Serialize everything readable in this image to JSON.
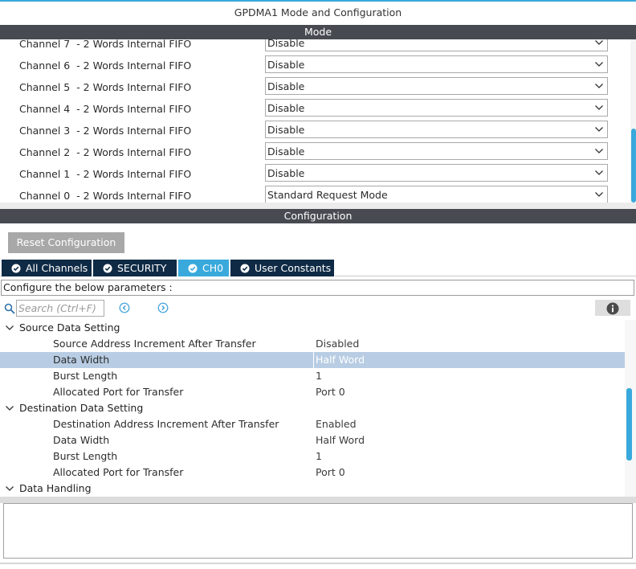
{
  "window": {
    "title": "GPDMA1 Mode and Configuration"
  },
  "mode": {
    "header": "Mode",
    "rows": [
      {
        "label": "Channel 7  - 2 Words Internal FIFO",
        "value": "Disable"
      },
      {
        "label": "Channel 6  - 2 Words Internal FIFO",
        "value": "Disable"
      },
      {
        "label": "Channel 5  - 2 Words Internal FIFO",
        "value": "Disable"
      },
      {
        "label": "Channel 4  - 2 Words Internal FIFO",
        "value": "Disable"
      },
      {
        "label": "Channel 3  - 2 Words Internal FIFO",
        "value": "Disable"
      },
      {
        "label": "Channel 2  - 2 Words Internal FIFO",
        "value": "Disable"
      },
      {
        "label": "Channel 1  - 2 Words Internal FIFO",
        "value": "Disable"
      },
      {
        "label": "Channel 0  - 2 Words Internal FIFO",
        "value": "Standard Request Mode"
      }
    ]
  },
  "configuration": {
    "header": "Configuration",
    "reset_label": "Reset Configuration",
    "tabs": [
      {
        "label": "All Channels",
        "active": false
      },
      {
        "label": "SECURITY",
        "active": false
      },
      {
        "label": "CH0",
        "active": true
      },
      {
        "label": "User Constants",
        "active": false
      }
    ],
    "caption": "Configure the below parameters :",
    "search_placeholder": "Search (Ctrl+F)",
    "groups": [
      {
        "label": "Source Data Setting",
        "params": [
          {
            "label": "Source Address Increment After Transfer",
            "value": "Disabled"
          },
          {
            "label": "Data Width",
            "value": "Half Word",
            "selected": true
          },
          {
            "label": "Burst Length",
            "value": "1"
          },
          {
            "label": "Allocated Port for Transfer",
            "value": "Port 0"
          }
        ]
      },
      {
        "label": "Destination Data Setting",
        "params": [
          {
            "label": "Destination Address Increment After Transfer",
            "value": "Enabled"
          },
          {
            "label": "Data Width",
            "value": "Half Word"
          },
          {
            "label": "Burst Length",
            "value": "1"
          },
          {
            "label": "Allocated Port for Transfer",
            "value": "Port 0"
          }
        ]
      },
      {
        "label": "Data Handling",
        "params": []
      }
    ]
  },
  "colors": {
    "accent": "#39a9dc",
    "bar_dark": "#474b51",
    "tab_dark": "#0e2a45",
    "selected_row": "#b8cde3"
  }
}
